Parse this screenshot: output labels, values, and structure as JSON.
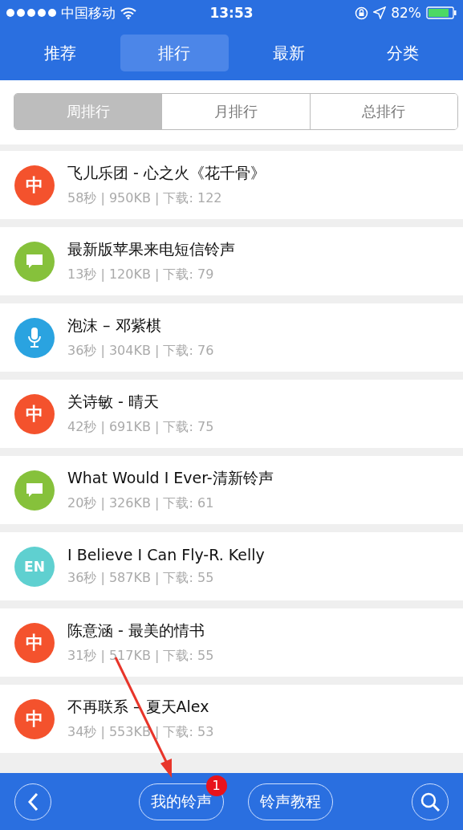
{
  "status_bar": {
    "carrier": "中国移动",
    "time": "13:53",
    "battery": "82%"
  },
  "tabs": [
    {
      "label": "推荐",
      "selected": false
    },
    {
      "label": "排行",
      "selected": true
    },
    {
      "label": "最新",
      "selected": false
    },
    {
      "label": "分类",
      "selected": false
    }
  ],
  "segments": [
    {
      "label": "周排行",
      "selected": true
    },
    {
      "label": "月排行",
      "selected": false
    },
    {
      "label": "总排行",
      "selected": false
    }
  ],
  "ringtones": [
    {
      "title": "飞儿乐团 - 心之火《花千骨》",
      "meta": "58秒 | 950KB | 下载: 122",
      "icon": {
        "kind": "text",
        "text": "中",
        "color": "#f4522d"
      }
    },
    {
      "title": "最新版苹果来电短信铃声",
      "meta": "13秒 | 120KB | 下载: 79",
      "icon": {
        "kind": "chat",
        "color": "#86c13b"
      }
    },
    {
      "title": "泡沫 – 邓紫棋",
      "meta": "36秒 | 304KB | 下载: 76",
      "icon": {
        "kind": "mic",
        "color": "#2aa3e0"
      }
    },
    {
      "title": "关诗敏 - 晴天",
      "meta": "42秒 | 691KB | 下载: 75",
      "icon": {
        "kind": "text",
        "text": "中",
        "color": "#f4522d"
      }
    },
    {
      "title": "What Would I Ever-清新铃声",
      "meta": "20秒 | 326KB | 下载: 61",
      "icon": {
        "kind": "chat",
        "color": "#86c13b"
      }
    },
    {
      "title": "I Believe I Can Fly-R. Kelly",
      "meta": "36秒 | 587KB | 下载: 55",
      "icon": {
        "kind": "text",
        "text": "EN",
        "color": "#5fd0d0"
      }
    },
    {
      "title": "陈意涵 - 最美的情书",
      "meta": "31秒 | 517KB | 下载: 55",
      "icon": {
        "kind": "text",
        "text": "中",
        "color": "#f4522d"
      }
    },
    {
      "title": "不再联系 – 夏天Alex",
      "meta": "34秒 | 553KB | 下载: 53",
      "icon": {
        "kind": "text",
        "text": "中",
        "color": "#f4522d"
      }
    }
  ],
  "bottom_bar": {
    "buttons": [
      {
        "label": "我的铃声",
        "badge": "1"
      },
      {
        "label": "铃声教程"
      }
    ]
  }
}
